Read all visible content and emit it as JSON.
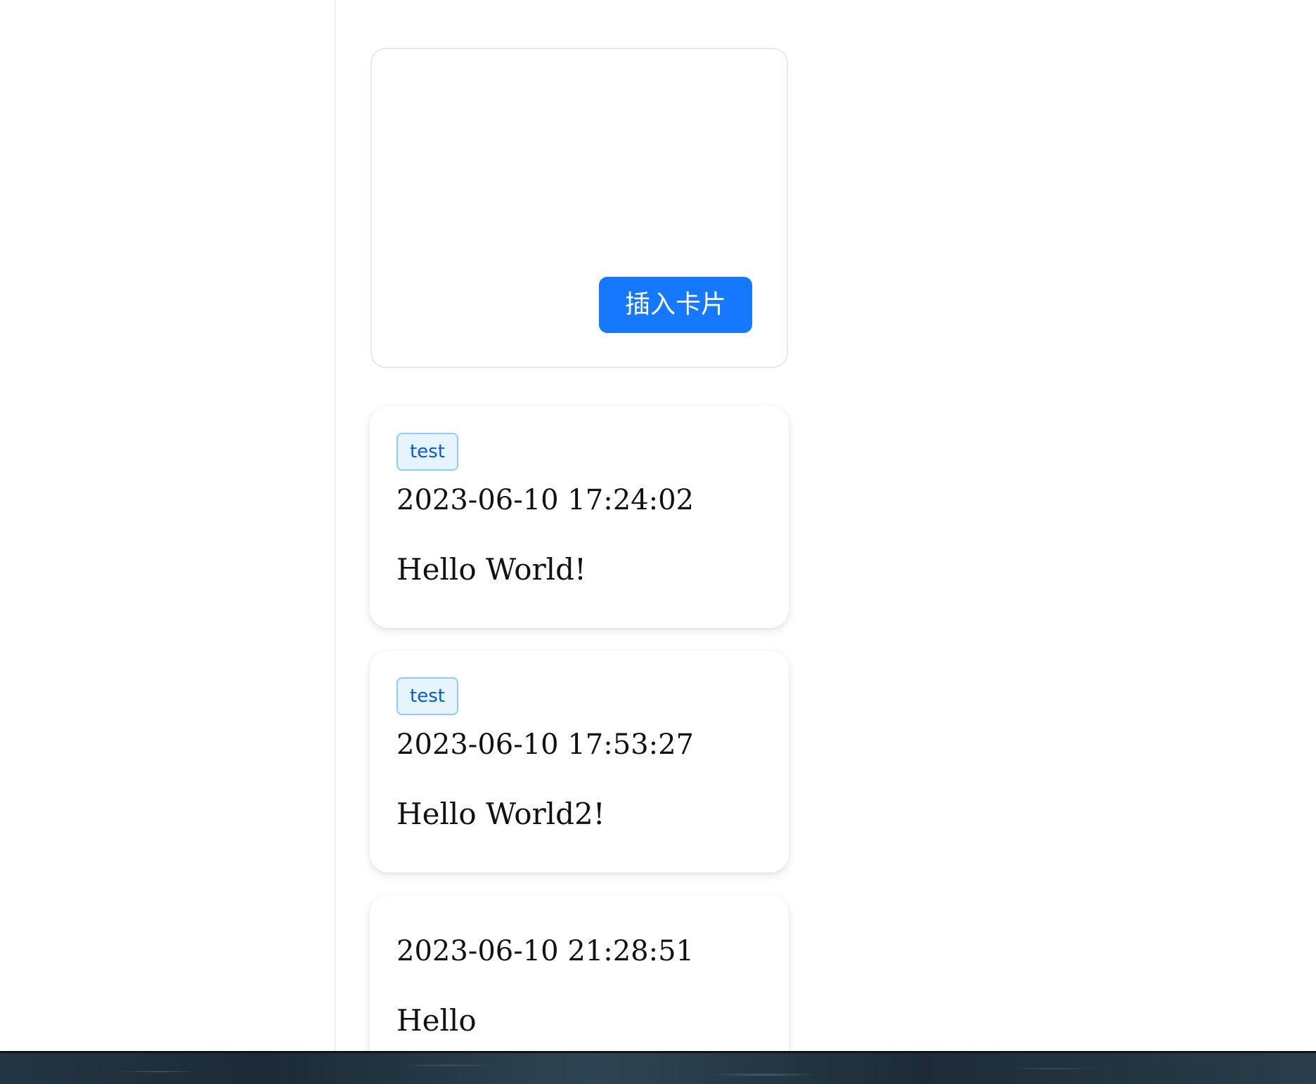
{
  "editor": {
    "placeholder": "",
    "insert_button_label": "插入卡片"
  },
  "posts": [
    {
      "tag": "test",
      "time": "2023-06-10 17:24:02",
      "content": "Hello World!"
    },
    {
      "tag": "test",
      "time": "2023-06-10 17:53:27",
      "content": "Hello World2!"
    },
    {
      "tag": "",
      "time": "2023-06-10 21:28:51",
      "content": "Hello"
    }
  ],
  "colors": {
    "primary": "#1677ff",
    "tag_background": "#e6f4ff",
    "tag_border": "#91caff",
    "tag_text": "#0958d9"
  }
}
